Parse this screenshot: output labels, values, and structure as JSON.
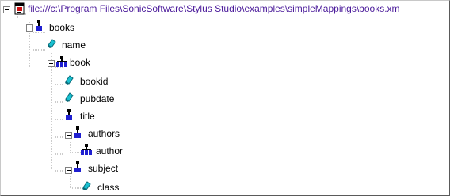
{
  "tree": {
    "root": {
      "label": "file:///c:\\Program Files\\SonicSoftware\\Stylus Studio\\examples\\simpleMappings\\books.xm",
      "icon": "xml-document-icon"
    },
    "nodes": [
      {
        "label": "books",
        "icon": "element-icon"
      },
      {
        "label": "name",
        "icon": "attribute-icon"
      },
      {
        "label": "book",
        "icon": "element-tree-icon"
      },
      {
        "label": "bookid",
        "icon": "attribute-icon"
      },
      {
        "label": "pubdate",
        "icon": "attribute-icon"
      },
      {
        "label": "title",
        "icon": "element-icon"
      },
      {
        "label": "authors",
        "icon": "element-icon"
      },
      {
        "label": "author",
        "icon": "element-tree-icon"
      },
      {
        "label": "subject",
        "icon": "element-icon"
      },
      {
        "label": "class",
        "icon": "attribute-icon"
      }
    ]
  },
  "colors": {
    "element_blue": "#1f1fd0",
    "attribute_cyan": "#18c0d0",
    "tree_line": "#9a9a9a"
  }
}
